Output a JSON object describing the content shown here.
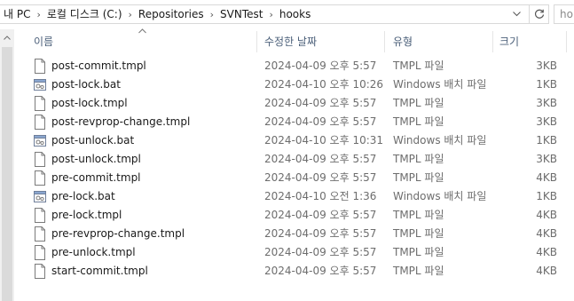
{
  "address": {
    "crumbs": [
      "내 PC",
      "로컬 디스크 (C:)",
      "Repositories",
      "SVNTest",
      "hooks"
    ],
    "separator": "›"
  },
  "search": {
    "placeholder": "ho"
  },
  "columns": {
    "name": "이름",
    "date": "수정한 날짜",
    "type": "유형",
    "size": "크기"
  },
  "files": [
    {
      "name": "post-commit.tmpl",
      "date": "2024-04-09 오후 5:57",
      "type": "TMPL 파일",
      "size": "3KB",
      "icon": "file-icon"
    },
    {
      "name": "post-lock.bat",
      "date": "2024-04-10 오후 10:26",
      "type": "Windows 배치 파일",
      "size": "1KB",
      "icon": "batch-file-icon"
    },
    {
      "name": "post-lock.tmpl",
      "date": "2024-04-09 오후 5:57",
      "type": "TMPL 파일",
      "size": "3KB",
      "icon": "file-icon"
    },
    {
      "name": "post-revprop-change.tmpl",
      "date": "2024-04-09 오후 5:57",
      "type": "TMPL 파일",
      "size": "3KB",
      "icon": "file-icon"
    },
    {
      "name": "post-unlock.bat",
      "date": "2024-04-10 오후 10:31",
      "type": "Windows 배치 파일",
      "size": "1KB",
      "icon": "batch-file-icon"
    },
    {
      "name": "post-unlock.tmpl",
      "date": "2024-04-09 오후 5:57",
      "type": "TMPL 파일",
      "size": "3KB",
      "icon": "file-icon"
    },
    {
      "name": "pre-commit.tmpl",
      "date": "2024-04-09 오후 5:57",
      "type": "TMPL 파일",
      "size": "4KB",
      "icon": "file-icon"
    },
    {
      "name": "pre-lock.bat",
      "date": "2024-04-10 오전 1:36",
      "type": "Windows 배치 파일",
      "size": "1KB",
      "icon": "batch-file-icon"
    },
    {
      "name": "pre-lock.tmpl",
      "date": "2024-04-09 오후 5:57",
      "type": "TMPL 파일",
      "size": "4KB",
      "icon": "file-icon"
    },
    {
      "name": "pre-revprop-change.tmpl",
      "date": "2024-04-09 오후 5:57",
      "type": "TMPL 파일",
      "size": "4KB",
      "icon": "file-icon"
    },
    {
      "name": "pre-unlock.tmpl",
      "date": "2024-04-09 오후 5:57",
      "type": "TMPL 파일",
      "size": "4KB",
      "icon": "file-icon"
    },
    {
      "name": "start-commit.tmpl",
      "date": "2024-04-09 오후 5:57",
      "type": "TMPL 파일",
      "size": "4KB",
      "icon": "file-icon"
    }
  ]
}
